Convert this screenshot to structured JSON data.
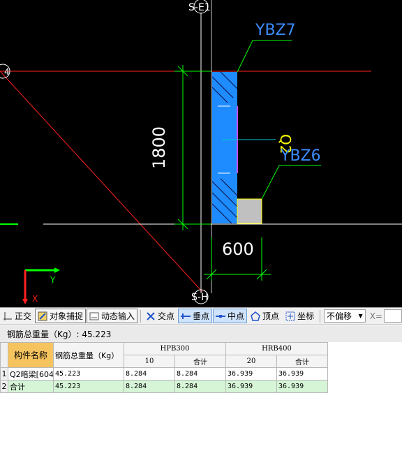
{
  "canvas": {
    "axis_top": "S-E1",
    "axis_bottom": "S-H",
    "axis_left": "4",
    "label_ybz7": "YBZ7",
    "label_ybz6": "YBZ6",
    "label_q2": "Q2",
    "dim_height": "1800",
    "dim_width": "600",
    "ucs_y": "Y",
    "ucs_x": "X",
    "colors": {
      "background": "#000000",
      "wall_fill": "#1e8cff",
      "column_fill": "#c0c0c0",
      "dimension": "#00ff00",
      "axis_red": "#ff2020",
      "label_blue": "#3c8cff",
      "label_yellow": "#ffff00"
    }
  },
  "toolbar": {
    "ortho": "正交",
    "snap": "对象捕捉",
    "dynamic_input": "动态输入",
    "intersection": "交点",
    "perpendicular": "垂点",
    "midpoint": "中点",
    "vertex": "顶点",
    "coordinate": "坐标",
    "offset_value": "不偏移",
    "x_label": "X="
  },
  "summary": {
    "text": "钢筋总重量（Kg）: 45.223"
  },
  "table": {
    "col_name": "构件名称",
    "col_total_weight": "钢筋总重量（Kg）",
    "group_hpb300": "HPB300",
    "group_hrb400": "HRB400",
    "sub_hpb_10": "10",
    "sub_hpb_total": "合计",
    "sub_hrb_20": "20",
    "sub_hrb_total": "合计",
    "rows": [
      {
        "num": "1",
        "name": "Q2暗梁[604",
        "total": "45.223",
        "hpb_10": "8.284",
        "hpb_sum": "8.284",
        "hrb_20": "36.939",
        "hrb_sum": "36.939"
      },
      {
        "num": "2",
        "name": "合计",
        "total": "45.223",
        "hpb_10": "8.284",
        "hpb_sum": "8.284",
        "hrb_20": "36.939",
        "hrb_sum": "36.939"
      }
    ]
  }
}
